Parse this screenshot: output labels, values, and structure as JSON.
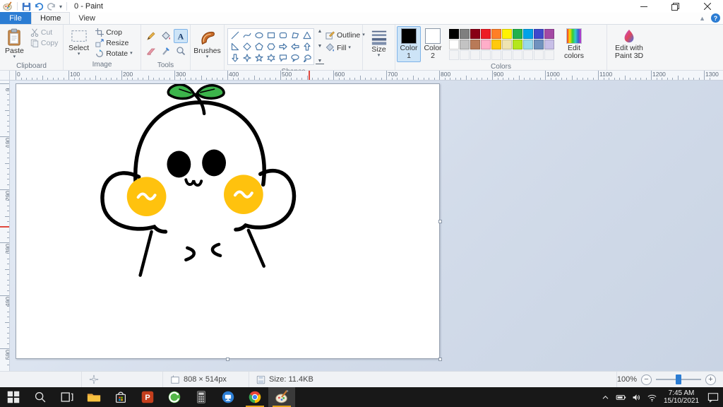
{
  "titlebar": {
    "title": "0 - Paint",
    "quick_access": [
      "paint-logo",
      "save",
      "undo",
      "redo",
      "qat-dropdown"
    ],
    "window_controls": [
      "minimize",
      "restore",
      "close"
    ]
  },
  "tabs": {
    "file": "File",
    "home": "Home",
    "view": "View",
    "help": "?",
    "collapse": "^"
  },
  "ribbon": {
    "clipboard": {
      "group_label": "Clipboard",
      "paste": "Paste",
      "cut": "Cut",
      "copy": "Copy"
    },
    "image": {
      "group_label": "Image",
      "select": "Select",
      "crop": "Crop",
      "resize": "Resize",
      "rotate": "Rotate"
    },
    "tools": {
      "group_label": "Tools",
      "items": [
        "pencil",
        "fill-bucket",
        "text",
        "eraser",
        "color-picker",
        "magnifier"
      ],
      "selected": "text"
    },
    "brushes": {
      "label": "Brushes"
    },
    "shapes": {
      "group_label": "Shapes",
      "outline": "Outline",
      "fill": "Fill",
      "items": [
        "line",
        "curve",
        "ellipse",
        "rectangle",
        "rounded-rectangle",
        "polygon",
        "triangle",
        "right-triangle",
        "diamond",
        "pentagon",
        "hexagon",
        "right-arrow",
        "left-arrow",
        "up-arrow",
        "down-arrow",
        "four-point-star",
        "five-point-star",
        "six-point-star",
        "rounded-callout",
        "oval-callout",
        "cloud-callout"
      ]
    },
    "size": {
      "label": "Size"
    },
    "colors": {
      "group_label": "Colors",
      "color1_label": "Color 1",
      "color2_label": "Color 2",
      "color1_value": "#000000",
      "color2_value": "#ffffff",
      "palette": [
        [
          "#000000",
          "#7f7f7f",
          "#880015",
          "#ed1c24",
          "#ff7f27",
          "#fff200",
          "#22b14c",
          "#00a2e8",
          "#3f48cc",
          "#a349a4"
        ],
        [
          "#ffffff",
          "#c3c3c3",
          "#b97a57",
          "#ffaec9",
          "#ffc90e",
          "#efe4b0",
          "#b5e61d",
          "#99d9ea",
          "#7092be",
          "#c8bfe7"
        ]
      ],
      "empty_slots": 10,
      "edit_colors_label": "Edit colors",
      "edit_3d_label": "Edit with Paint 3D"
    }
  },
  "rulers": {
    "horizontal": [
      "0",
      "100",
      "200",
      "300",
      "400",
      "500",
      "600",
      "700",
      "800",
      "900",
      "1000",
      "1100",
      "1200",
      "1300"
    ],
    "vertical": [
      "0",
      "100",
      "200",
      "300",
      "400",
      "500"
    ],
    "marker_color": "#e0483e"
  },
  "drawing": {
    "description": "cute sprout-head character doodle",
    "outline_color": "#000000",
    "leaf_color": "#3cb44b",
    "cheek_color": "#ffc20e"
  },
  "statusbar": {
    "dimensions": "808 × 514px",
    "file_size": "Size: 11.4KB",
    "zoom_level": "100%"
  },
  "taskbar": {
    "items": [
      "start",
      "search",
      "task-view",
      "file-explorer",
      "microsoft-store",
      "powerpoint",
      "green-media-app",
      "calculator",
      "blue-screen-app",
      "chrome",
      "paint"
    ],
    "active_item": "paint",
    "underlined_items": [
      "chrome",
      "paint"
    ],
    "tray_icons": [
      "chevron-up",
      "battery",
      "volume",
      "wifi"
    ],
    "tray": {
      "time": "7:45 AM",
      "date": "15/10/2021"
    },
    "action_center": "action-center"
  }
}
